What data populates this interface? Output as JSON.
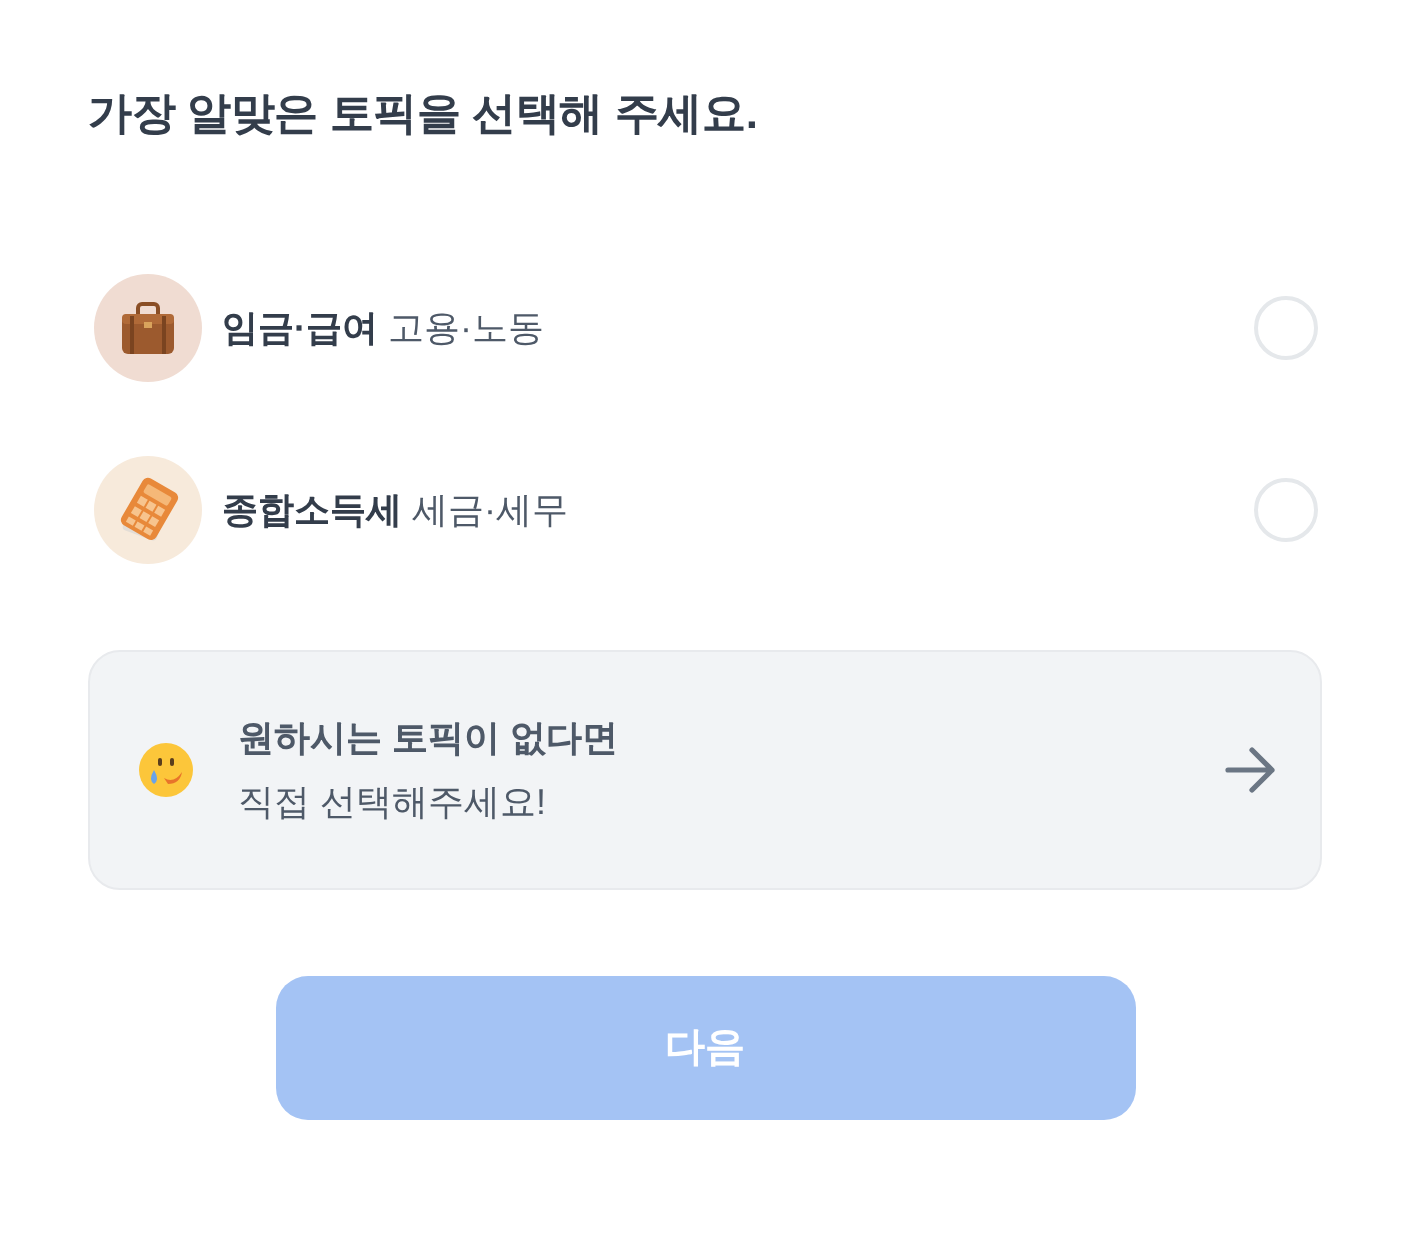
{
  "title": "가장 알맞은 토픽을 선택해 주세요.",
  "topics": [
    {
      "kind": "briefcase",
      "name": "임금·급여",
      "category": "고용·노동",
      "selected": false
    },
    {
      "kind": "calculator",
      "name": "종합소득세",
      "category": "세금·세무",
      "selected": false
    }
  ],
  "custom_topic_card": {
    "title": "원하시는 토픽이 없다면",
    "subtitle": "직접 선택해주세요!"
  },
  "next_button": {
    "label": "다음",
    "disabled": true
  }
}
